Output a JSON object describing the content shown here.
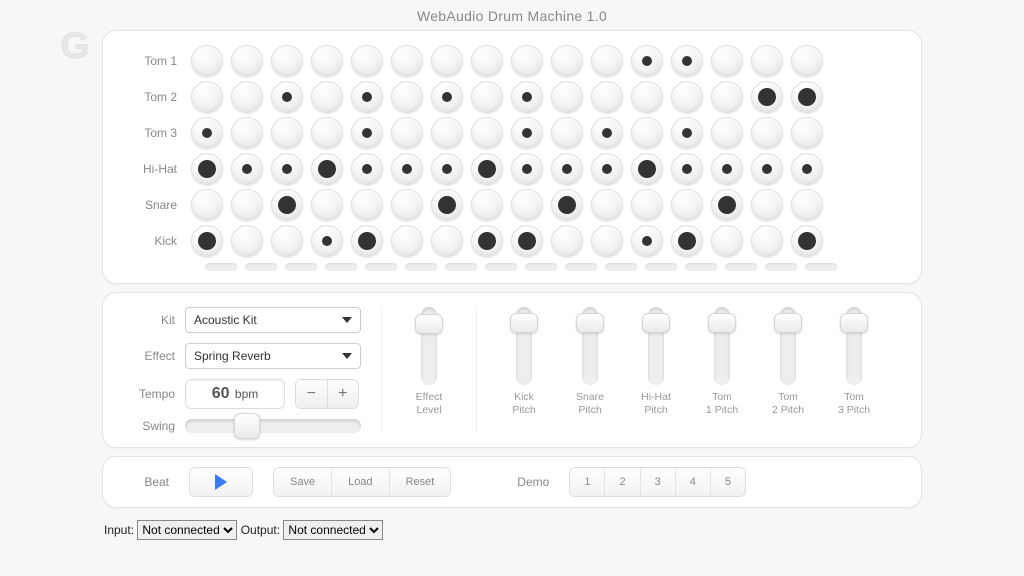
{
  "title": "WebAudio Drum Machine 1.0",
  "logo_letter": "G",
  "tracks": [
    {
      "name": "Tom 1",
      "steps": [
        0,
        0,
        0,
        0,
        0,
        0,
        0,
        0,
        0,
        0,
        0,
        1,
        1,
        0,
        0,
        0
      ]
    },
    {
      "name": "Tom 2",
      "steps": [
        0,
        0,
        1,
        0,
        1,
        0,
        1,
        0,
        1,
        0,
        0,
        0,
        0,
        0,
        2,
        2
      ]
    },
    {
      "name": "Tom 3",
      "steps": [
        1,
        0,
        0,
        0,
        1,
        0,
        0,
        0,
        1,
        0,
        1,
        0,
        1,
        0,
        0,
        0
      ]
    },
    {
      "name": "Hi-Hat",
      "steps": [
        2,
        1,
        1,
        2,
        1,
        1,
        1,
        2,
        1,
        1,
        1,
        2,
        1,
        1,
        1,
        1
      ]
    },
    {
      "name": "Snare",
      "steps": [
        0,
        0,
        2,
        0,
        0,
        0,
        2,
        0,
        0,
        2,
        0,
        0,
        0,
        2,
        0,
        0
      ]
    },
    {
      "name": "Kick",
      "steps": [
        2,
        0,
        0,
        1,
        2,
        0,
        0,
        2,
        2,
        0,
        0,
        1,
        2,
        0,
        0,
        2
      ]
    }
  ],
  "kit": {
    "label": "Kit",
    "value": "Acoustic Kit"
  },
  "effect": {
    "label": "Effect",
    "value": "Spring Reverb"
  },
  "tempo": {
    "label": "Tempo",
    "bpm": "60",
    "unit": "bpm"
  },
  "swing": {
    "label": "Swing",
    "pos": 0.28
  },
  "sliders": [
    {
      "label": "Effect Level",
      "pos": 0.12
    },
    {
      "label": "Kick Pitch",
      "pos": 0.1
    },
    {
      "label": "Snare Pitch",
      "pos": 0.1
    },
    {
      "label": "Hi-Hat Pitch",
      "pos": 0.1
    },
    {
      "label": "Tom 1 Pitch",
      "pos": 0.1
    },
    {
      "label": "Tom 2 Pitch",
      "pos": 0.1
    },
    {
      "label": "Tom 3 Pitch",
      "pos": 0.1
    }
  ],
  "transport": {
    "beat_label": "Beat",
    "save": "Save",
    "load": "Load",
    "reset": "Reset",
    "demo_label": "Demo",
    "demos": [
      "1",
      "2",
      "3",
      "4",
      "5"
    ]
  },
  "midi": {
    "input_label": "Input:",
    "input_value": "Not connected",
    "output_label": "Output:",
    "output_value": "Not connected"
  }
}
